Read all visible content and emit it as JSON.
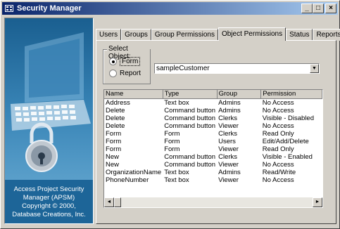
{
  "window": {
    "title": "Security Manager",
    "controls": {
      "minimize": "_",
      "maximize": "□",
      "close": "×"
    }
  },
  "left_panel": {
    "credit_lines": [
      "Access Project Security",
      "Manager (APSM)",
      "Copyright © 2000,",
      "Database Creations, Inc."
    ]
  },
  "tabs": [
    "Users",
    "Groups",
    "Group Permissions",
    "Object Permissions",
    "Status",
    "Reports"
  ],
  "active_tab": "Object Permissions",
  "select_object": {
    "legend": "Select Object:",
    "options": [
      {
        "label": "Form",
        "selected": true
      },
      {
        "label": "Report",
        "selected": false
      }
    ],
    "combo_value": "sampleCustomer"
  },
  "permissions": {
    "columns": [
      "Name",
      "Type",
      "Group",
      "Permission"
    ],
    "rows": [
      [
        "Address",
        "Text box",
        "Admins",
        "No Access"
      ],
      [
        "Delete",
        "Command button",
        "Admins",
        "No Access"
      ],
      [
        "Delete",
        "Command button",
        "Clerks",
        "Visible - Disabled"
      ],
      [
        "Delete",
        "Command button",
        "Viewer",
        "No Access"
      ],
      [
        "Form",
        "Form",
        "Clerks",
        "Read Only"
      ],
      [
        "Form",
        "Form",
        "Users",
        "Edit/Add/Delete"
      ],
      [
        "Form",
        "Form",
        "Viewer",
        "Read Only"
      ],
      [
        "New",
        "Command button",
        "Clerks",
        "Visible - Enabled"
      ],
      [
        "New",
        "Command button",
        "Viewer",
        "No Access"
      ],
      [
        "OrganizationName",
        "Text box",
        "Admins",
        "Read/Write"
      ],
      [
        "PhoneNumber",
        "Text box",
        "Viewer",
        "No Access"
      ]
    ]
  },
  "scrollbar": {
    "left_arrow": "◄",
    "right_arrow": "►"
  },
  "icons": {
    "app": "app-grid-icon",
    "combo": "dropdown-arrow-icon"
  },
  "colors": {
    "desktop": "#f4c3a3",
    "titlebar_start": "#0a246a",
    "titlebar_end": "#a6caf0",
    "art_panel": "#1d6598"
  }
}
